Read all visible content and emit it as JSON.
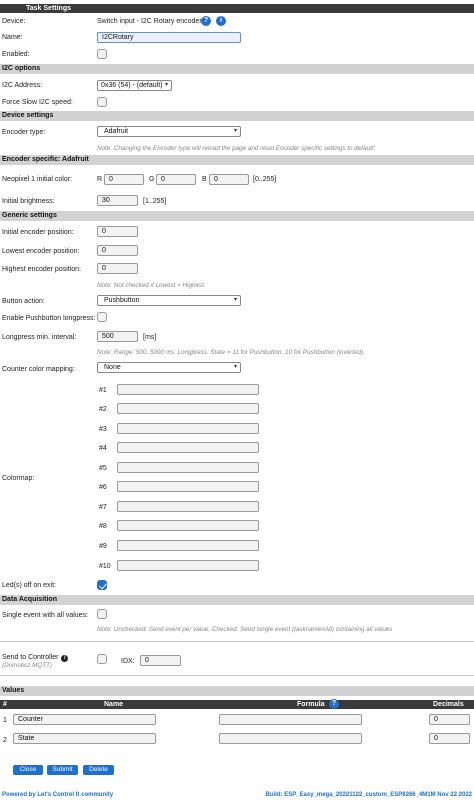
{
  "header": {
    "title": "Task Settings"
  },
  "task": {
    "device_label": "Device:",
    "device_value": "Switch input - I2C Rotary encoders",
    "name_label": "Name:",
    "name_value": "I2CRotary",
    "enabled_label": "Enabled:",
    "enabled": false
  },
  "i2c": {
    "section": "I2C options",
    "address_label": "I2C Address:",
    "address_value": "0x36 (54) - (default)",
    "slow_label": "Force Slow I2C speed:",
    "slow": false
  },
  "device_settings": {
    "section": "Device settings",
    "encoder_type_label": "Encoder type:",
    "encoder_type_value": "Adafruit",
    "note": "Note: Changing the Encoder type will reload the page and reset Encoder specific settings to default!"
  },
  "encoder_specific": {
    "section": "Encoder specific: Adafruit",
    "color_label": "Neopixel 1 initial color:",
    "r_label": "R",
    "r_value": "0",
    "g_label": "G",
    "g_value": "0",
    "b_label": "B",
    "b_value": "0",
    "range_hint": "[0..255]",
    "brightness_label": "Initial brightness:",
    "brightness_value": "30",
    "brightness_hint": "[1..255]"
  },
  "generic": {
    "section": "Generic settings",
    "initial_pos_label": "Initial encoder position:",
    "initial_pos_value": "0",
    "lowest_pos_label": "Lowest encoder position:",
    "lowest_pos_value": "0",
    "highest_pos_label": "Highest encoder position:",
    "highest_pos_value": "0",
    "pos_note": "Note: Not checked if Lowest = Highest.",
    "button_action_label": "Button action:",
    "button_action_value": "Pushbutton",
    "longpress_enable_label": "Enable Pushbutton longpress:",
    "longpress_enable": false,
    "longpress_interval_label": "Longpress min. interval:",
    "longpress_interval_value": "500",
    "longpress_unit": "[ms]",
    "longpress_note": "Note: Range: 500..5000 ms. Longpress: State = 11 for Pushbutton, 10 for Pushbutton (inverted).",
    "color_mapping_label": "Counter color mapping:",
    "color_mapping_value": "None",
    "colormap_label": "Colormap:",
    "colormap": [
      "#1",
      "#2",
      "#3",
      "#4",
      "#5",
      "#6",
      "#7",
      "#8",
      "#9",
      "#10"
    ],
    "leds_off_label": "Led(s) off on exit:",
    "leds_off": true
  },
  "data_acq": {
    "section": "Data Acquisition",
    "single_event_label": "Single event with all values:",
    "single_event": false,
    "note": "Note: Unchecked: Send event per value. Checked: Send single event (taskname#All) containing all values",
    "send_label": "Send to Controller",
    "send_sub": "(Domoticz MQTT)",
    "send_enabled": false,
    "idx_label": "IDX:",
    "idx_value": "0"
  },
  "values": {
    "section": "Values",
    "columns": [
      "#",
      "Name",
      "Formula",
      "Decimals"
    ],
    "rows": [
      {
        "num": "1",
        "name": "Counter",
        "formula": "",
        "decimals": "0"
      },
      {
        "num": "2",
        "name": "State",
        "formula": "",
        "decimals": "0"
      }
    ]
  },
  "buttons": {
    "close": "Close",
    "submit": "Submit",
    "delete": "Delete"
  },
  "footer": {
    "powered": "Powered by Let's Control It community",
    "build": "Build: ESP_Easy_mega_20221122_custom_ESP8266_4M1M Nov 22 2022"
  },
  "icons": {
    "help": "help-icon",
    "info": "info-icon",
    "dropdown": "chevron-down-icon"
  },
  "colors": {
    "accent": "#1f6fcf",
    "header": "#3a3a3a",
    "section": "#d2d2d2",
    "note": "#888888"
  }
}
